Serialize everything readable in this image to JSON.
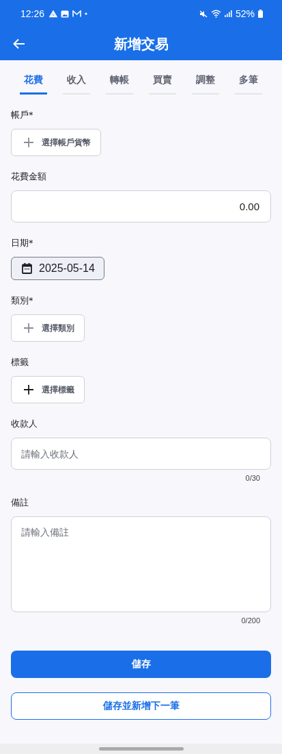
{
  "status_bar": {
    "time": "12:26",
    "battery": "52%"
  },
  "app_bar": {
    "title": "新增交易"
  },
  "tabs": [
    {
      "label": "花費",
      "selected": true
    },
    {
      "label": "收入",
      "selected": false
    },
    {
      "label": "轉帳",
      "selected": false
    },
    {
      "label": "買賣",
      "selected": false
    },
    {
      "label": "調整",
      "selected": false
    },
    {
      "label": "多筆",
      "selected": false
    }
  ],
  "fields": [
    {
      "kind": "picker",
      "label": "帳戶*",
      "button": "選擇帳戶貨幣",
      "dimmed": true
    },
    {
      "kind": "amount",
      "label": "花費金額",
      "value": "0.00"
    },
    {
      "kind": "date",
      "label": "日期*",
      "value": "2025-05-14"
    },
    {
      "kind": "picker",
      "label": "類別*",
      "button": "選擇類別",
      "dimmed": true
    },
    {
      "kind": "picker",
      "label": "標籤",
      "button": "選擇標籤",
      "dimmed": false
    },
    {
      "kind": "text",
      "label": "收款人",
      "placeholder": "請輸入收款人",
      "counter": "0/30"
    },
    {
      "kind": "textarea",
      "label": "備註",
      "placeholder": "請輸入備註",
      "counter": "0/200"
    }
  ],
  "buttons": [
    {
      "kind": "primary",
      "label": "儲存"
    },
    {
      "kind": "outline",
      "label": "儲存並新增下一筆"
    }
  ]
}
